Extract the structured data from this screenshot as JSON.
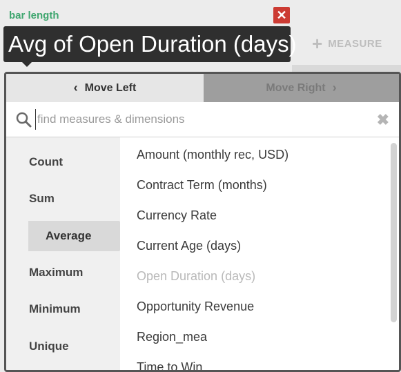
{
  "header": {
    "label": "bar length",
    "close_glyph": "✕",
    "measure_title": "Avg of Open Duration (days)",
    "add_glyph": "+",
    "add_label": "MEASURE"
  },
  "tabs": {
    "move_left": "Move Left",
    "move_right": "Move Right"
  },
  "search": {
    "placeholder": "find measures & dimensions",
    "value": "",
    "clear_glyph": "✖"
  },
  "aggregations": [
    {
      "label": "Count",
      "selected": false
    },
    {
      "label": "Sum",
      "selected": false
    },
    {
      "label": "Average",
      "selected": true
    },
    {
      "label": "Maximum",
      "selected": false
    },
    {
      "label": "Minimum",
      "selected": false
    },
    {
      "label": "Unique",
      "selected": false
    }
  ],
  "fields": [
    {
      "label": "Amount (monthly rec, USD)",
      "disabled": false
    },
    {
      "label": "Contract Term (months)",
      "disabled": false
    },
    {
      "label": "Currency Rate",
      "disabled": false
    },
    {
      "label": "Current Age (days)",
      "disabled": false
    },
    {
      "label": "Open Duration (days)",
      "disabled": true
    },
    {
      "label": "Opportunity Revenue",
      "disabled": false
    },
    {
      "label": "Region_mea",
      "disabled": false
    },
    {
      "label": "Time to Win",
      "disabled": false
    }
  ],
  "icons": {
    "close": "close-icon",
    "add": "plus-icon",
    "prev": "chevron-left-icon",
    "next": "chevron-right-icon",
    "search": "search-icon",
    "clear": "clear-icon"
  },
  "colors": {
    "label_green": "#3fa66f",
    "close_red": "#cc3b33",
    "pill_dark": "#2f2f2f"
  }
}
